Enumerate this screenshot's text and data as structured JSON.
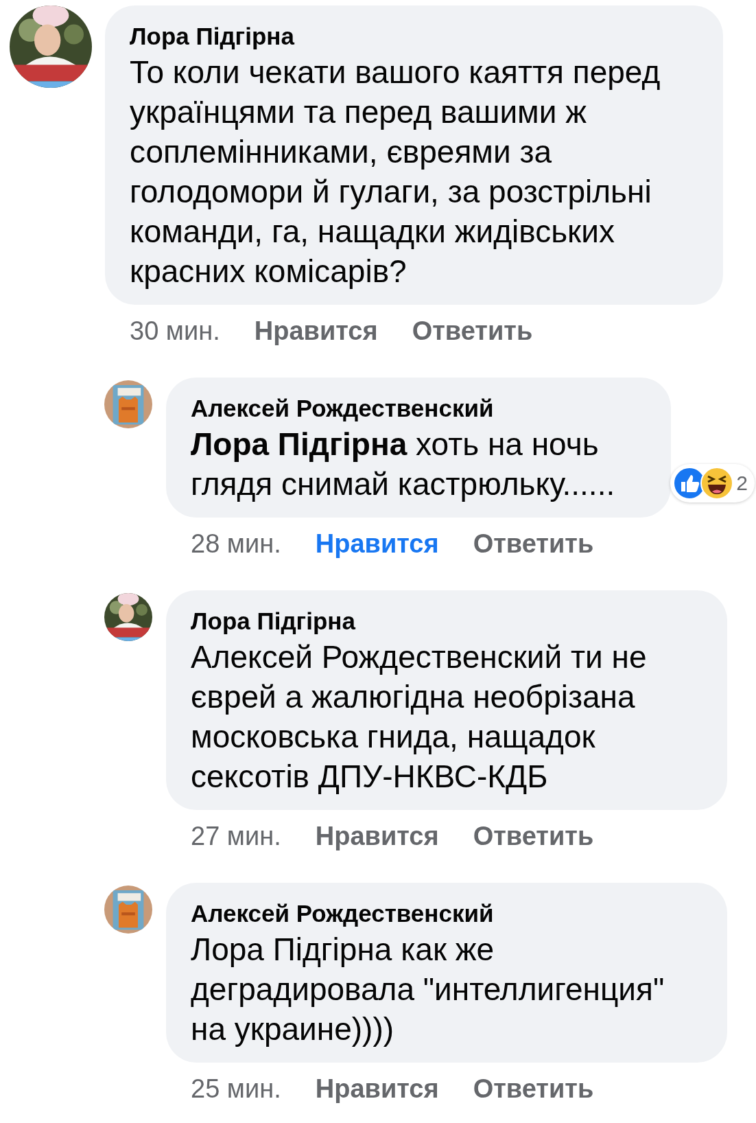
{
  "comments": [
    {
      "author": "Лора Підгірна",
      "indented": false,
      "text": "То коли чекати вашого каяття перед українцями та перед вашими ж соплемінниками, євреями за голодомори й гулаги, за розстрільні команди, га, нащадки жидівських красних комісарів?",
      "time": "30 мин.",
      "like_label": "Нравится",
      "liked": false,
      "reply_label": "Ответить"
    },
    {
      "author": "Алексей Рождественский",
      "indented": true,
      "text": "**Лора Підгірна** хоть на ночь глядя снимай кастрюльку......",
      "reactions": {
        "count": "2"
      },
      "time": "28 мин.",
      "like_label": "Нравится",
      "liked": true,
      "reply_label": "Ответить"
    },
    {
      "author": "Лора Підгірна",
      "indented": true,
      "text": "Алексей Рождественский  ти не єврей а жалюгідна необрізана московська гнида, нащадок сексотів ДПУ-НКВС-КДБ",
      "time": "27 мин.",
      "like_label": "Нравится",
      "liked": false,
      "reply_label": "Ответить"
    },
    {
      "author": "Алексей Рождественский",
      "indented": true,
      "text": "Лора Підгірна как же деградировала \"интеллигенция\" на украине))))",
      "time": "25 мин.",
      "like_label": "Нравится",
      "liked": false,
      "reply_label": "Ответить"
    }
  ]
}
